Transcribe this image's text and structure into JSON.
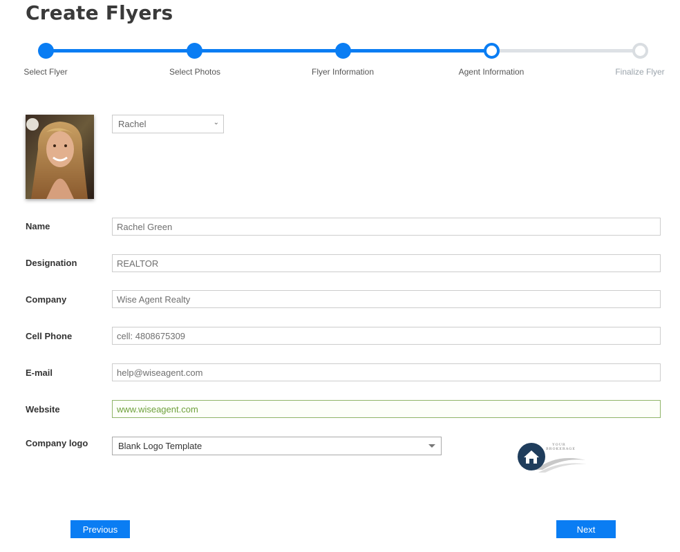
{
  "page": {
    "title": "Create Flyers"
  },
  "stepper": {
    "steps": [
      {
        "label": "Select Flyer",
        "state": "done"
      },
      {
        "label": "Select Photos",
        "state": "done"
      },
      {
        "label": "Flyer Information",
        "state": "done"
      },
      {
        "label": "Agent Information",
        "state": "current"
      },
      {
        "label": "Finalize Flyer",
        "state": "todo"
      }
    ],
    "accent": "#0a7df3",
    "inactive": "#d9dde1"
  },
  "agent": {
    "selected": "Rachel"
  },
  "form": {
    "name": {
      "label": "Name",
      "value": "Rachel Green"
    },
    "designation": {
      "label": "Designation",
      "value": "REALTOR"
    },
    "company": {
      "label": "Company",
      "value": "Wise Agent Realty"
    },
    "cell_phone": {
      "label": "Cell Phone",
      "value": "cell: 4808675309"
    },
    "email": {
      "label": "E-mail",
      "value": "help@wiseagent.com"
    },
    "website": {
      "label": "Website",
      "value": "www.wiseagent.com"
    },
    "company_logo": {
      "label": "Company logo",
      "value": "Blank Logo Template"
    }
  },
  "logo_preview": {
    "line1": "YOUR",
    "line2": "BROKERAGE",
    "icon": "house-icon"
  },
  "buttons": {
    "previous": "Previous",
    "next": "Next"
  }
}
